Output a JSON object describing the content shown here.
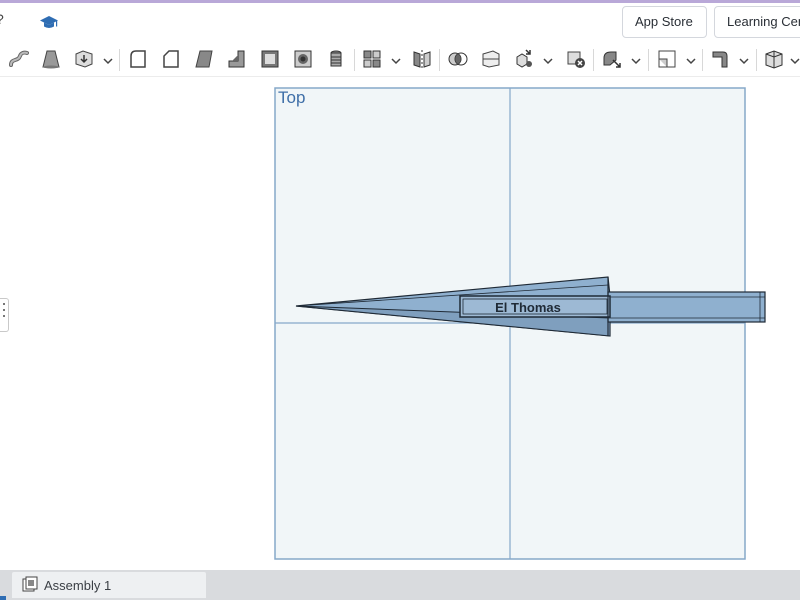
{
  "header": {
    "left_glyph": "?",
    "learning_icon": "graduation-cap-icon",
    "app_store_label": "App Store",
    "learning_center_label": "Learning Center"
  },
  "toolbar": {
    "icons": [
      "sweep-icon",
      "loft-icon",
      "thicken-icon",
      "fillet-icon",
      "chamfer-icon",
      "draft-icon",
      "rib-icon",
      "shell-icon",
      "hole-icon",
      "thread-icon",
      "pattern-icon",
      "mirror-icon",
      "boolean-icon",
      "split-icon",
      "transform-icon",
      "delete-part-icon",
      "modify-fillet-icon",
      "plane-icon",
      "sheet-metal-icon",
      "frame-icon"
    ]
  },
  "viewport": {
    "view_label": "Top",
    "part_text": "El Thomas",
    "colors": {
      "part_fill": "#8fb0cf",
      "part_edge": "#1f2a36",
      "plane_fill": "#f1f6f8",
      "plane_edge": "#86a8c9"
    }
  },
  "tabs": {
    "active_label": "Assembly 1",
    "active_icon": "assembly-icon"
  }
}
